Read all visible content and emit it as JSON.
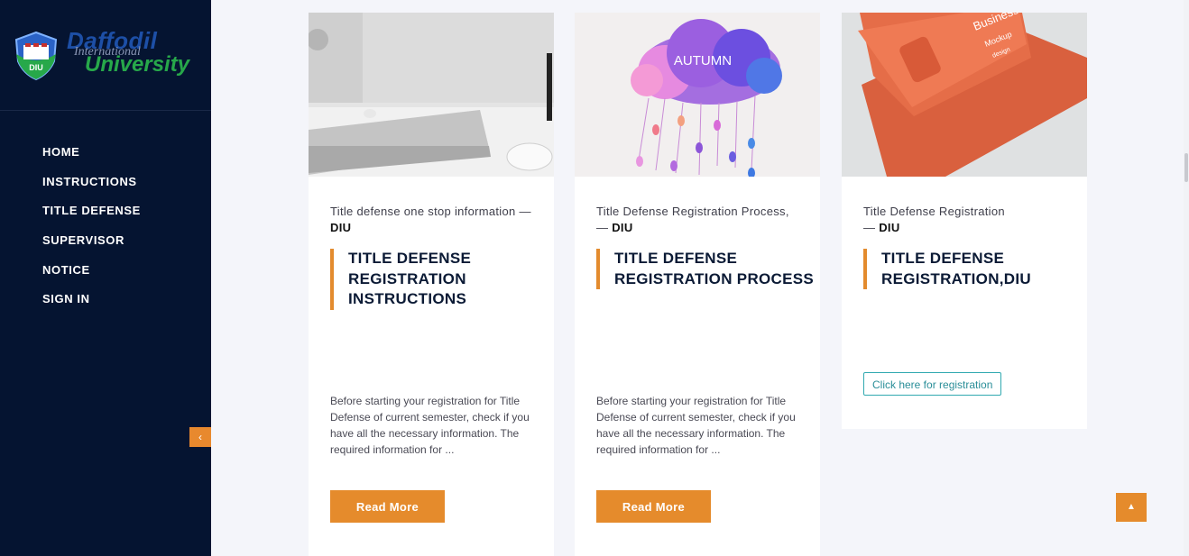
{
  "sidebar": {
    "logo": {
      "line1": "Daffodil",
      "line2": "International",
      "line3": "University",
      "badge_text": "DIU"
    },
    "items": [
      {
        "label": "HOME"
      },
      {
        "label": "INSTRUCTIONS"
      },
      {
        "label": "TITLE DEFENSE"
      },
      {
        "label": "SUPERVISOR"
      },
      {
        "label": "NOTICE"
      },
      {
        "label": "SIGN IN"
      }
    ],
    "collapse_icon": "chevron-left-icon",
    "collapse_glyph": "‹"
  },
  "cards": [
    {
      "subtitle": "Title defense one stop information",
      "dash": " — ",
      "org": "DIU",
      "title": "TITLE DEFENSE REGISTRATION INSTRUCTIONS",
      "desc": "Before starting your registration for Title Defense of current semester, check if you have all the necessary information. The required information for ...",
      "button": "Read More"
    },
    {
      "subtitle": "Title Defense Registration Process,",
      "dash": " — ",
      "org": "DIU",
      "title": "TITLE DEFENSE REGISTRATION PROCESS",
      "desc": "Before starting your registration for Title Defense of current semester, check if you have all the necessary information. The required information for ...",
      "button": "Read More",
      "image_text": "AUTUMN"
    },
    {
      "subtitle": "Title Defense Registration",
      "dash": "— ",
      "org": "DIU",
      "title": "TITLE DEFENSE REGISTRATION,DIU",
      "button": "Click here for registration",
      "image_text": "Business",
      "image_text2": "Mockup",
      "image_text3": "design"
    }
  ],
  "scroll_top_icon": "arrow-up-icon",
  "scroll_top_glyph": "▲",
  "colors": {
    "sidebar_bg": "#051431",
    "accent": "#e58b2c",
    "title": "#0b1a35",
    "outline_btn": "#30a9b0"
  }
}
